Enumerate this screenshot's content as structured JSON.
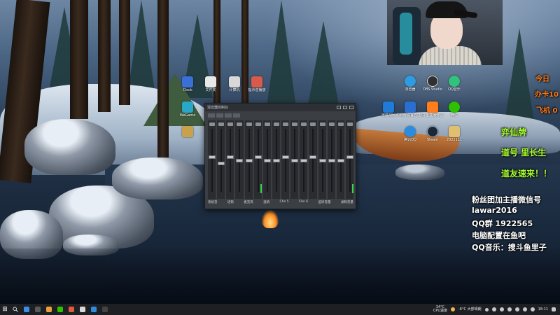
{
  "desktop_icons": [
    {
      "label": "Clock",
      "color": "#3b6fd8"
    },
    {
      "label": "WeGame",
      "color": "#2aa7c8"
    },
    {
      "label": "",
      "color": "#c9a14a"
    },
    {
      "label": "文件夹",
      "color": "#e8e8e8"
    },
    {
      "label": "计算机",
      "color": "#d8d8d8"
    },
    {
      "label": "提示音播放",
      "color": "#d85a4a"
    },
    {
      "label": "浏览器",
      "color": "#2f9be0"
    },
    {
      "label": "OBS Studio",
      "color": "#303030"
    },
    {
      "label": "QQ音乐",
      "color": "#31c27c"
    },
    {
      "label": "雷霆战网",
      "color": "#1e7bd8"
    },
    {
      "label": "炉石传说官方插件",
      "color": "#2a6fd0"
    },
    {
      "label": "斗鱼直播伴侣",
      "color": "#ff7d1a"
    },
    {
      "label": "微信",
      "color": "#2dc100"
    },
    {
      "label": "腾讯QQ",
      "color": "#2b8de0"
    },
    {
      "label": "Steam",
      "color": "#1b2838"
    },
    {
      "label": "2022111",
      "color": "#e0c070"
    }
  ],
  "overlay": {
    "today_label": "今日",
    "stuck_label": "办卡10",
    "fly_label": "飞机 0",
    "line1": "弈仙牌",
    "line2": "道号 里长生",
    "line3": "道友速来！！",
    "fans_group": "粉丝团加主播微信号",
    "wechat_id": "lawar2016",
    "qq_group": "QQ群 1922565",
    "pc_config": "电脑配置在鱼吧",
    "qq_music": "QQ音乐：搜斗鱼里子"
  },
  "mixer": {
    "title": "混音器控制台",
    "channels": [
      {
        "level": 0.55,
        "meter": 0.0
      },
      {
        "level": 0.45,
        "meter": 0.0
      },
      {
        "level": 0.55,
        "meter": 0.0
      },
      {
        "level": 0.5,
        "meter": 0.0
      },
      {
        "level": 0.5,
        "meter": 0.0
      },
      {
        "level": 0.55,
        "meter": 0.15
      },
      {
        "level": 0.5,
        "meter": 0.0
      },
      {
        "level": 0.5,
        "meter": 0.0
      },
      {
        "level": 0.55,
        "meter": 0.0
      },
      {
        "level": 0.5,
        "meter": 0.0
      },
      {
        "level": 0.5,
        "meter": 0.0
      },
      {
        "level": 0.55,
        "meter": 0.0
      },
      {
        "level": 0.5,
        "meter": 0.0
      },
      {
        "level": 0.5,
        "meter": 0.0
      },
      {
        "level": 0.5,
        "meter": 0.0
      },
      {
        "level": 0.55,
        "meter": 0.15
      }
    ],
    "labels": [
      "系统音",
      "话筒",
      "麦克风",
      "混响",
      "Chn 5",
      "Chn 6",
      "监听音量",
      "录制音量"
    ]
  },
  "taskbar": {
    "apps": [
      {
        "color": "#3b8ee8"
      },
      {
        "color": "#5a5a5a"
      },
      {
        "color": "#e8a13a"
      },
      {
        "color": "#2dc100"
      },
      {
        "color": "#e35a3a"
      },
      {
        "color": "#d9d9d9"
      },
      {
        "color": "#2b8de0"
      },
      {
        "color": "#444444"
      }
    ],
    "cpu_temp": "34°C",
    "cpu_label": "CPU温度",
    "weather": "-6°C 大部晴朗",
    "clock_time": "18:11"
  }
}
